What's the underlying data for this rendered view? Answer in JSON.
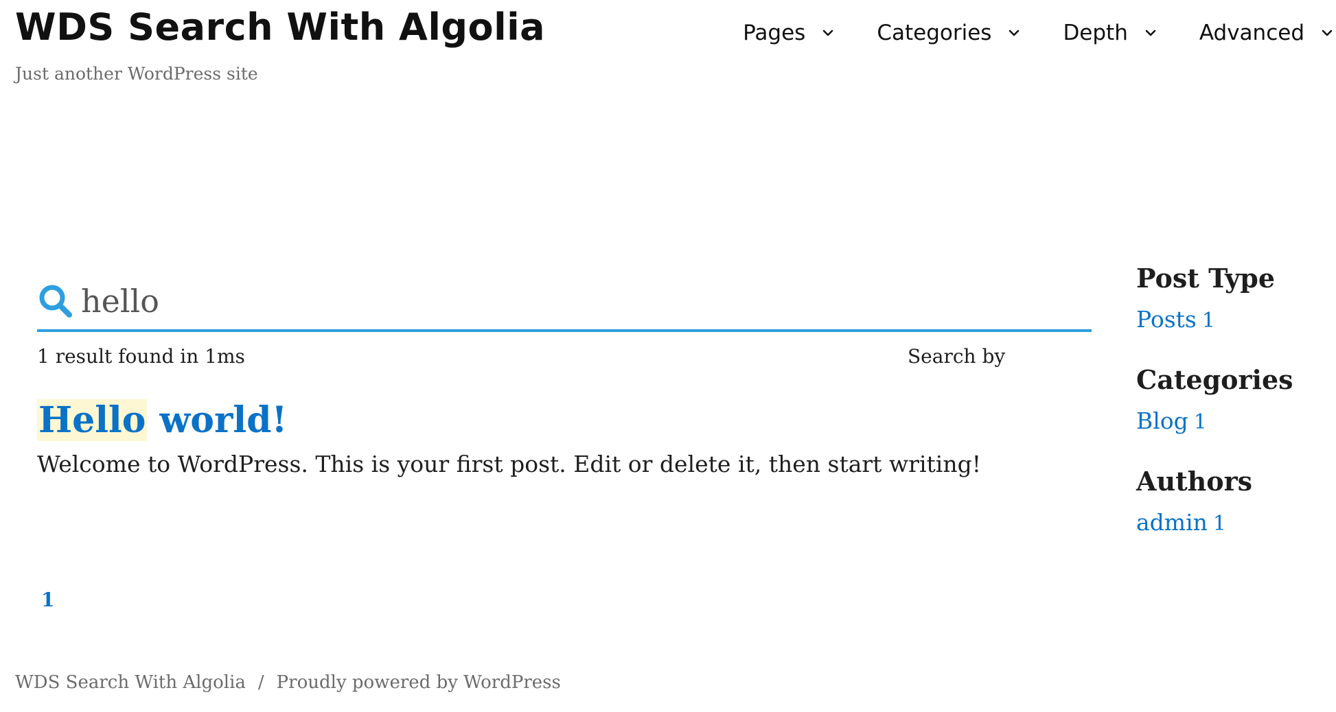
{
  "site": {
    "title": "WDS Search With Algolia",
    "tagline": "Just another WordPress site"
  },
  "nav": {
    "items": [
      {
        "label": "Pages",
        "icon": "chevron-down-icon"
      },
      {
        "label": "Categories",
        "icon": "chevron-down-icon"
      },
      {
        "label": "Depth",
        "icon": "chevron-down-icon"
      },
      {
        "label": "Advanced",
        "icon": "chevron-down-icon"
      }
    ]
  },
  "search": {
    "value": "hello",
    "icon": "search-icon",
    "accent_color": "#2d9fe0"
  },
  "stats": {
    "text": "1 result found in 1ms",
    "search_by": "Search by"
  },
  "results": [
    {
      "title_highlight": "Hello",
      "title_rest": " world!",
      "snippet": "Welcome to WordPress. This is your first post. Edit or delete it, then start writing!"
    }
  ],
  "pagination": {
    "current": "1"
  },
  "facets": [
    {
      "heading": "Post Type",
      "items": [
        {
          "label": "Posts",
          "count": "1"
        }
      ]
    },
    {
      "heading": "Categories",
      "items": [
        {
          "label": "Blog",
          "count": "1"
        }
      ]
    },
    {
      "heading": "Authors",
      "items": [
        {
          "label": "admin",
          "count": "1"
        }
      ]
    }
  ],
  "footer": {
    "site_link": "WDS Search With Algolia",
    "separator": "/",
    "powered_by": "Proudly powered by WordPress"
  },
  "colors": {
    "link": "#0a72c7",
    "highlight": "#fdf7d3",
    "muted_text": "#6b6b6b"
  }
}
